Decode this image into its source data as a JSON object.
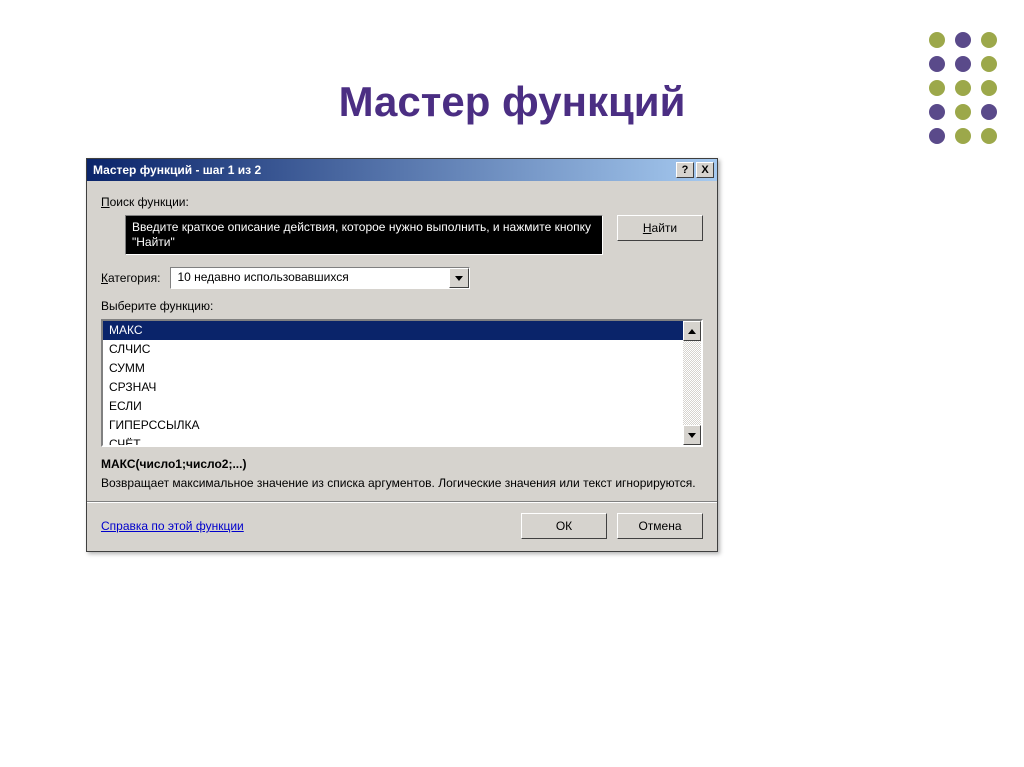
{
  "slide": {
    "title": "Мастер функций"
  },
  "decor": {
    "colors": [
      "#9ca84a",
      "#5a4a8a",
      "#9ca84a",
      "#5a4a8a",
      "#5a4a8a",
      "#9ca84a",
      "#9ca84a",
      "#9ca84a",
      "#9ca84a",
      "#5a4a8a",
      "#9ca84a",
      "#5a4a8a",
      "#5a4a8a",
      "#9ca84a",
      "#9ca84a"
    ]
  },
  "dialog": {
    "title": "Мастер функций - шаг 1 из 2",
    "help_glyph": "?",
    "close_glyph": "X",
    "search": {
      "label_pre": "П",
      "label_rest": "оиск функции:",
      "text": "Введите краткое описание действия, которое нужно выполнить, и нажмите кнопку \"Найти\"",
      "find_btn_pre": "Н",
      "find_btn_rest": "айти"
    },
    "category": {
      "label_pre": "К",
      "label_rest": "атегория:",
      "value": "10 недавно использовавшихся"
    },
    "select_label": "Выберите функцию:",
    "functions": [
      "МАКС",
      "СЛЧИС",
      "СУММ",
      "СРЗНАЧ",
      "ЕСЛИ",
      "ГИПЕРССЫЛКА",
      "СЧЁТ"
    ],
    "selected_index": 0,
    "signature": "МАКС(число1;число2;...)",
    "description": "Возвращает максимальное значение из списка аргументов. Логические значения или текст игнорируются.",
    "help_link": "Справка по этой функции",
    "ok_label": "ОК",
    "cancel_label": "Отмена"
  }
}
